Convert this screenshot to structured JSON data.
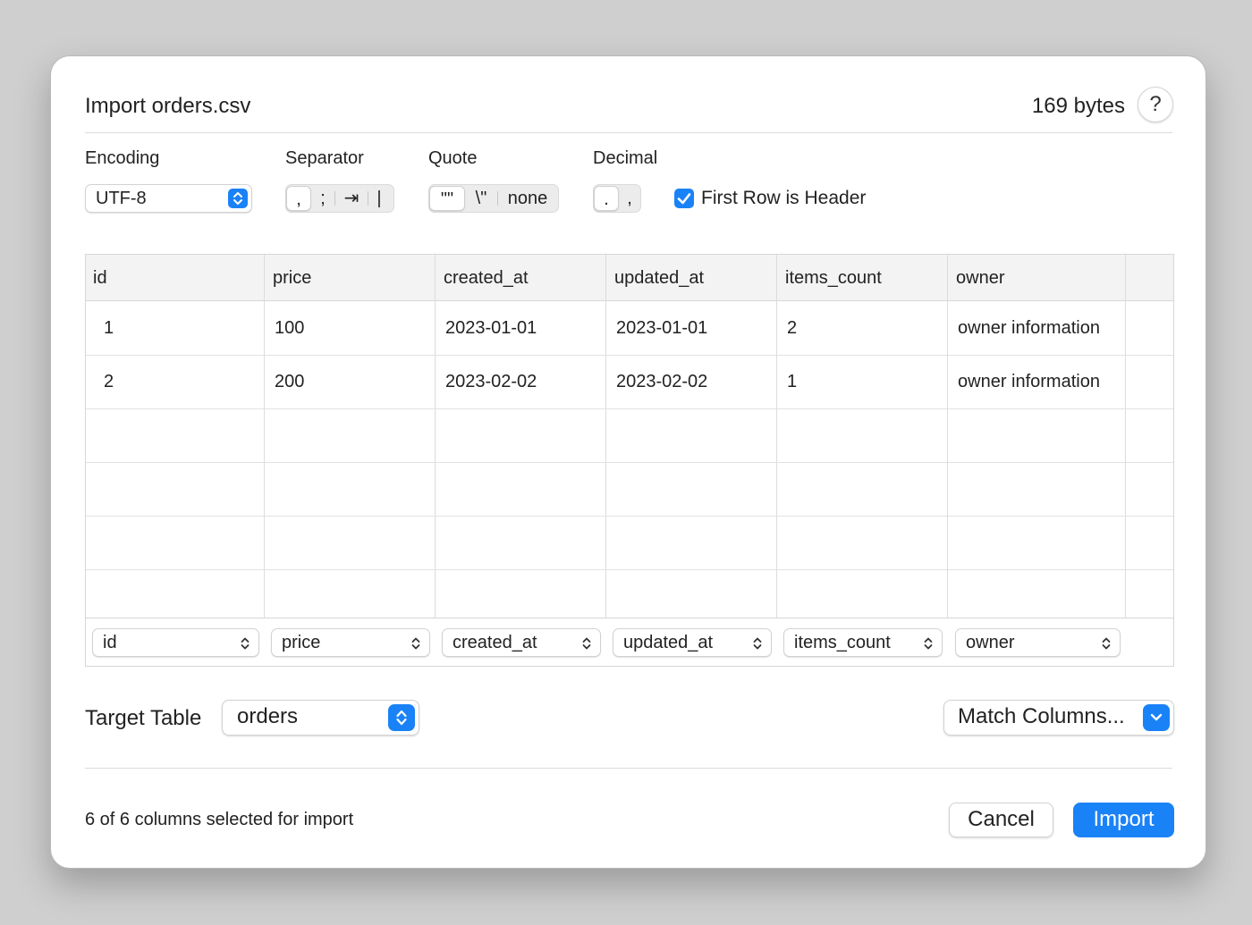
{
  "dialog": {
    "title": "Import orders.csv",
    "size": "169 bytes",
    "help_label": "?"
  },
  "options": {
    "encoding": {
      "label": "Encoding",
      "value": "UTF-8"
    },
    "separator": {
      "label": "Separator",
      "items": [
        ",",
        ";",
        "⇥",
        "|"
      ],
      "selected": ","
    },
    "quote": {
      "label": "Quote",
      "items": [
        "\"\"",
        "\\\"",
        "none"
      ],
      "selected": "\"\""
    },
    "decimal": {
      "label": "Decimal",
      "items": [
        ".",
        ","
      ],
      "selected": "."
    },
    "first_row_header": {
      "label": "First Row is Header",
      "checked": true
    }
  },
  "table": {
    "headers": [
      "id",
      "price",
      "created_at",
      "updated_at",
      "items_count",
      "owner"
    ],
    "rows": [
      [
        "1",
        "100",
        "2023-01-01",
        "2023-01-01",
        "2",
        "owner information"
      ],
      [
        "2",
        "200",
        "2023-02-02",
        "2023-02-02",
        "1",
        "owner information"
      ]
    ],
    "column_mapping": [
      "id",
      "price",
      "created_at",
      "updated_at",
      "items_count",
      "owner"
    ]
  },
  "target": {
    "label": "Target Table",
    "value": "orders"
  },
  "match_columns_label": "Match Columns...",
  "status": "6 of 6 columns selected for import",
  "buttons": {
    "cancel": "Cancel",
    "import": "Import"
  },
  "colors": {
    "accent": "#1a82f7",
    "header_bg": "#f3f3f3"
  }
}
